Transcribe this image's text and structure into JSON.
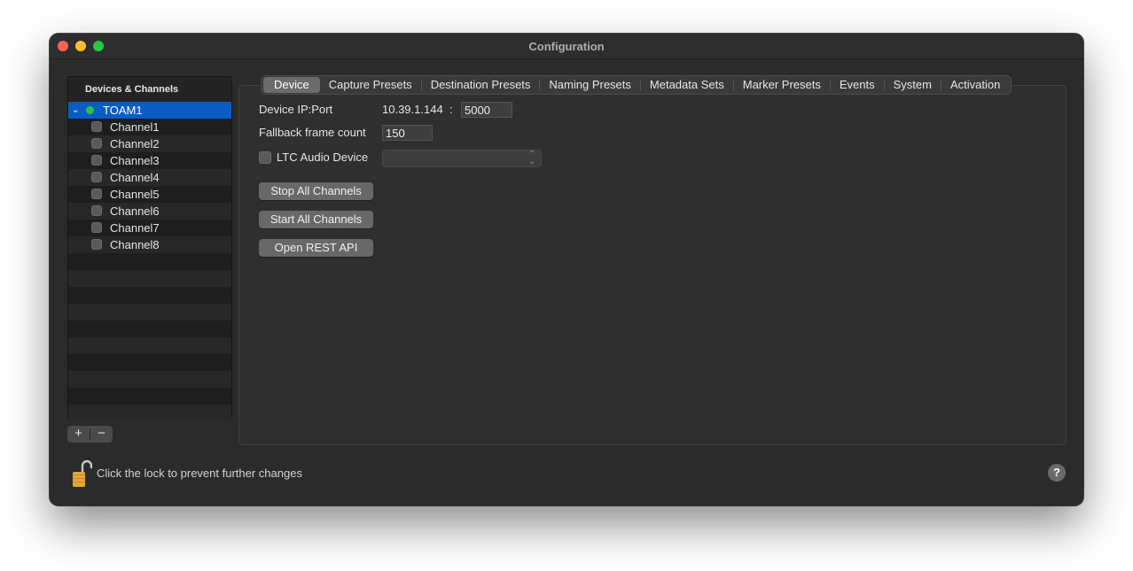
{
  "window": {
    "title": "Configuration"
  },
  "sidebar": {
    "header": "Devices & Channels",
    "device": {
      "name": "TOAM1",
      "status_color": "#2fc24a",
      "expanded": true
    },
    "channels": [
      {
        "label": "Channel1"
      },
      {
        "label": "Channel2"
      },
      {
        "label": "Channel3"
      },
      {
        "label": "Channel4"
      },
      {
        "label": "Channel5"
      },
      {
        "label": "Channel6"
      },
      {
        "label": "Channel7"
      },
      {
        "label": "Channel8"
      }
    ],
    "add_label": "+",
    "remove_label": "−"
  },
  "tabs": [
    {
      "label": "Device",
      "active": true
    },
    {
      "label": "Capture Presets"
    },
    {
      "label": "Destination Presets"
    },
    {
      "label": "Naming Presets"
    },
    {
      "label": "Metadata Sets"
    },
    {
      "label": "Marker Presets"
    },
    {
      "label": "Events"
    },
    {
      "label": "System"
    },
    {
      "label": "Activation"
    }
  ],
  "device": {
    "ip_port_label": "Device IP:Port",
    "ip": "10.39.1.144",
    "colon": ":",
    "port": "5000",
    "fallback_label": "Fallback frame count",
    "fallback_value": "150",
    "ltc_label": "LTC Audio Device",
    "ltc_checked": false,
    "ltc_value": "",
    "buttons": {
      "stop": "Stop All Channels",
      "start": "Start All Channels",
      "rest": "Open REST API"
    }
  },
  "footer": {
    "lock_text": "Click the lock to prevent further changes",
    "help_label": "?"
  },
  "colors": {
    "selection": "#0a5dc2",
    "status_green": "#2fc24a",
    "lock_gold": "#e6a63c"
  }
}
